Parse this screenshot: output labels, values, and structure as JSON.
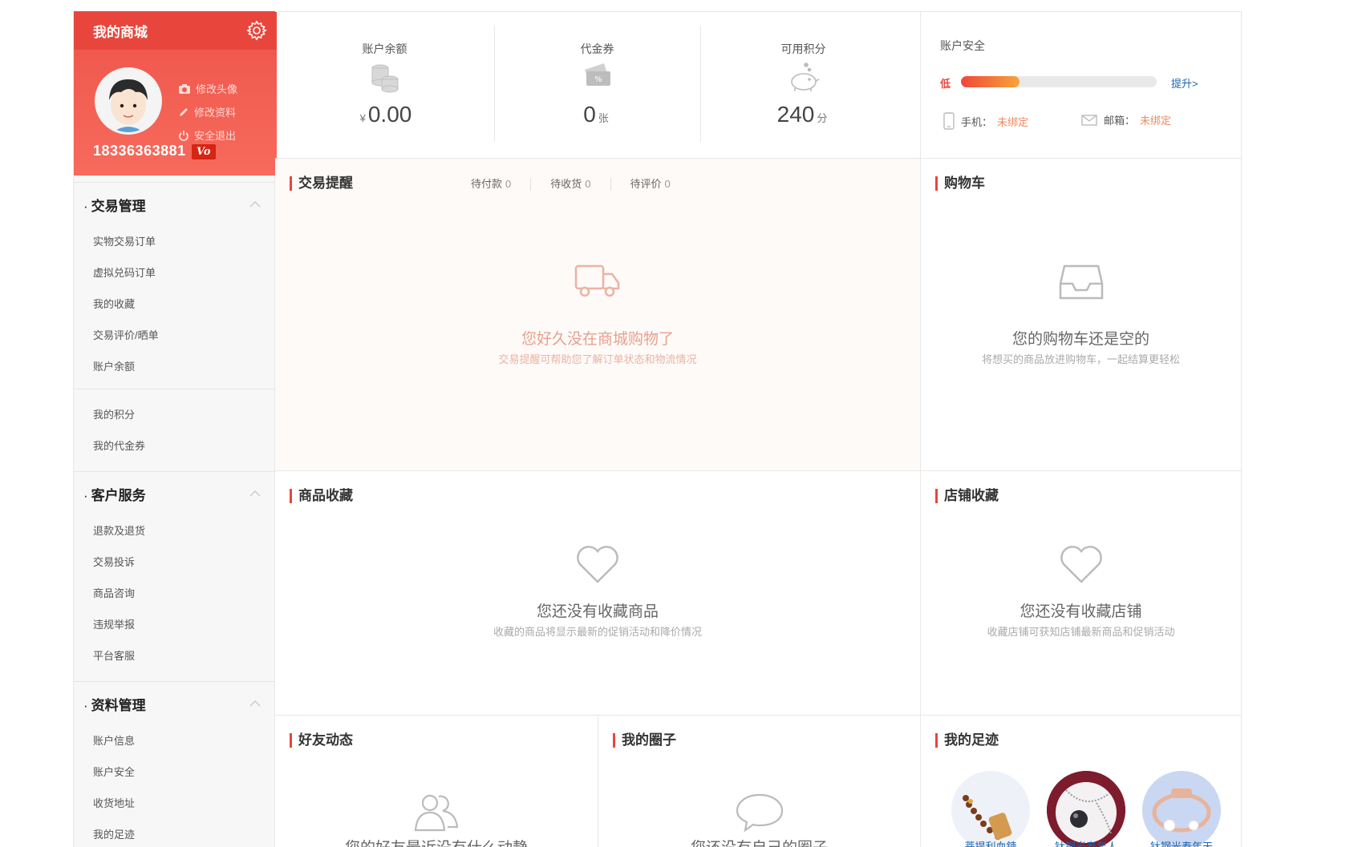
{
  "profile": {
    "title": "我的商城",
    "links": [
      "修改头像",
      "修改资料",
      "安全退出"
    ],
    "phone": "18336363881",
    "vip": "Vo"
  },
  "menu": {
    "trade": {
      "title": "交易管理",
      "items": [
        "实物交易订单",
        "虚拟兑码订单",
        "我的收藏",
        "交易评价/晒单",
        "账户余额"
      ],
      "items2": [
        "我的积分",
        "我的代金券"
      ]
    },
    "service": {
      "title": "客户服务",
      "items": [
        "退款及退货",
        "交易投诉",
        "商品咨询",
        "违规举报",
        "平台客服"
      ]
    },
    "profile_mgmt": {
      "title": "资料管理",
      "items": [
        "账户信息",
        "账户安全",
        "收货地址",
        "我的足迹"
      ]
    }
  },
  "stats": {
    "balance": {
      "label": "账户余额",
      "prefix": "¥",
      "value": "0.00"
    },
    "voucher": {
      "label": "代金券",
      "value": "0",
      "unit": "张"
    },
    "points": {
      "label": "可用积分",
      "value": "240",
      "unit": "分"
    }
  },
  "security": {
    "label": "账户安全",
    "level": "低",
    "level_fraction": 0.3,
    "upgrade": "提升>",
    "phone_label": "手机：",
    "phone_value": "未绑定",
    "email_label": "邮箱：",
    "email_value": "未绑定"
  },
  "trade_reminder": {
    "title": "交易提醒",
    "tabs": [
      {
        "label": "待付款",
        "count": "0"
      },
      {
        "label": "待收货",
        "count": "0"
      },
      {
        "label": "待评价",
        "count": "0"
      }
    ],
    "empty_main": "您好久没在商城购物了",
    "empty_sub": "交易提醒可帮助您了解订单状态和物流情况"
  },
  "cart": {
    "title": "购物车",
    "empty_main": "您的购物车还是空的",
    "empty_sub": "将想买的商品放进购物车，一起结算更轻松"
  },
  "fav_goods": {
    "title": "商品收藏",
    "empty_main": "您还没有收藏商品",
    "empty_sub": "收藏的商品将显示最新的促销活动和降价情况"
  },
  "fav_stores": {
    "title": "店铺收藏",
    "empty_main": "您还没有收藏店铺",
    "empty_sub": "收藏店铺可获知店铺最新商品和促销活动"
  },
  "friends": {
    "title": "好友动态",
    "empty_main": "您的好友最近没有什么动静"
  },
  "circle": {
    "title": "我的圈子",
    "empty_main": "您还没有自己的圈子"
  },
  "footprint": {
    "title": "我的足迹",
    "items": [
      "菩提利血鍊",
      "钛钢光寿年人",
      "钛钢光寿年天"
    ]
  },
  "colors": {
    "accent": "#e8463c",
    "link": "#1a66b3",
    "reminder_bg": "#fdfaf8"
  }
}
